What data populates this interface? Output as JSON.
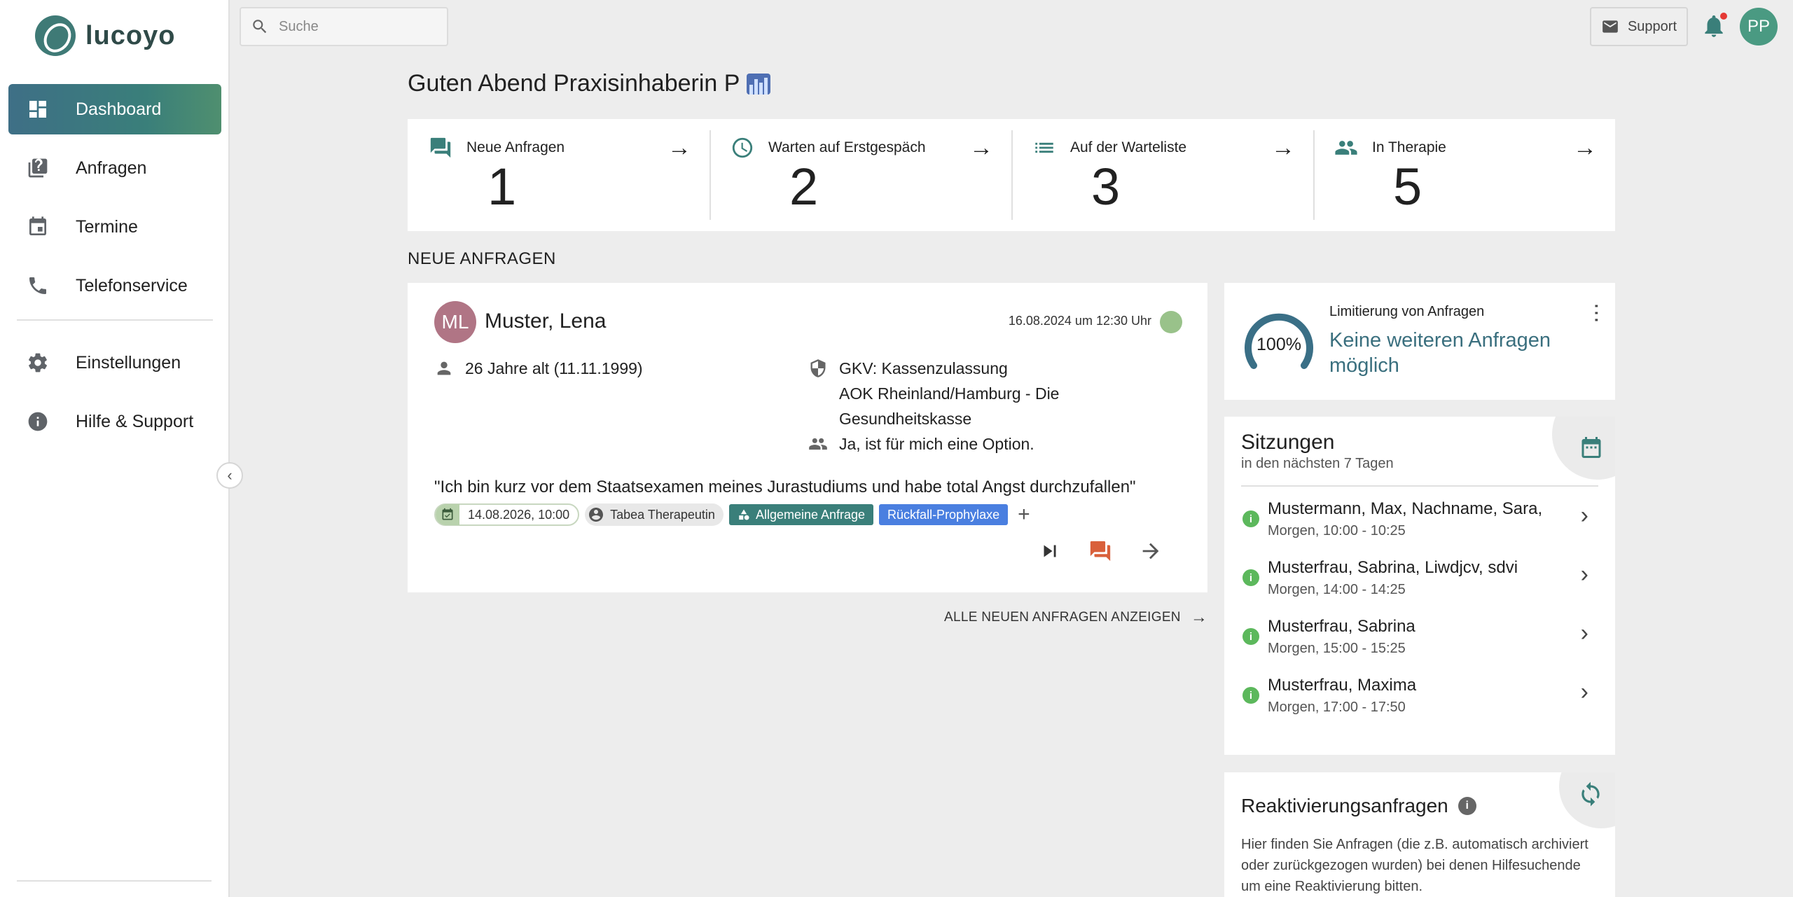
{
  "app": {
    "name": "lucoyo"
  },
  "sidebar": {
    "items": [
      {
        "label": "Dashboard",
        "icon": "dashboard-icon",
        "active": true
      },
      {
        "label": "Anfragen",
        "icon": "requests-icon"
      },
      {
        "label": "Termine",
        "icon": "calendar-icon"
      },
      {
        "label": "Telefonservice",
        "icon": "phone-icon"
      }
    ],
    "bottom_items": [
      {
        "label": "Einstellungen",
        "icon": "gear-icon"
      },
      {
        "label": "Hilfe & Support",
        "icon": "info-icon"
      }
    ]
  },
  "topbar": {
    "search_placeholder": "Suche",
    "support_label": "Support",
    "avatar_initials": "PP"
  },
  "greeting": "Guten Abend Praxisinhaberin P",
  "stats": [
    {
      "label": "Neue Anfragen",
      "value": "1",
      "icon": "chat-icon"
    },
    {
      "label": "Warten auf Erstgespäch",
      "value": "2",
      "icon": "clock-icon"
    },
    {
      "label": "Auf der Warteliste",
      "value": "3",
      "icon": "list-icon"
    },
    {
      "label": "In Therapie",
      "value": "5",
      "icon": "people-icon"
    }
  ],
  "new_requests": {
    "section_title": "NEUE ANFRAGEN",
    "request": {
      "initials": "ML",
      "name": "Muster, Lena",
      "date": "16.08.2024 um 12:30 Uhr",
      "age": "26 Jahre alt (11.11.1999)",
      "insurance_line1": "GKV: Kassenzulassung",
      "insurance_line2": "AOK Rheinland/Hamburg - Die",
      "insurance_line3": "Gesundheitskasse",
      "group_option": "Ja, ist für mich eine Option.",
      "quote": "\"Ich bin kurz vor dem Staatsexamen meines Jurastudiums und habe total Angst durchzufallen\"",
      "tags": {
        "appointment": "14.08.2026, 10:00",
        "therapist": "Tabea Therapeutin",
        "category": "Allgemeine Anfrage",
        "topic": "Rückfall-Prophylaxe"
      }
    },
    "show_all_label": "ALLE NEUEN ANFRAGEN ANZEIGEN"
  },
  "limit": {
    "label": "Limitierung von Anfragen",
    "value": "Keine weiteren Anfragen möglich",
    "percent": 100,
    "percent_label": "100%"
  },
  "sessions": {
    "title": "Sitzungen",
    "subtitle": "in den nächsten 7 Tagen",
    "items": [
      {
        "name": "Mustermann, Max, Nachname, Sara,",
        "time": "Morgen, 10:00 - 10:25"
      },
      {
        "name": "Musterfrau, Sabrina, Liwdjcv, sdvi",
        "time": "Morgen, 14:00 - 14:25"
      },
      {
        "name": "Musterfrau, Sabrina",
        "time": "Morgen, 15:00 - 15:25"
      },
      {
        "name": "Musterfrau, Maxima",
        "time": "Morgen, 17:00 - 17:50"
      }
    ]
  },
  "reactivation": {
    "title": "Reaktivierungsanfragen",
    "text": "Hier finden Sie Anfragen (die z.B. automatisch archiviert oder zurückgezogen wurden) bei denen Hilfesuchende um eine Reaktivierung bitten."
  },
  "colors": {
    "brand": "#3a7f7a",
    "accent_blue": "#4a7fe0",
    "chat_orange": "#d9603b",
    "avatar_ml": "#b07585",
    "status_green": "#5cb85c"
  }
}
